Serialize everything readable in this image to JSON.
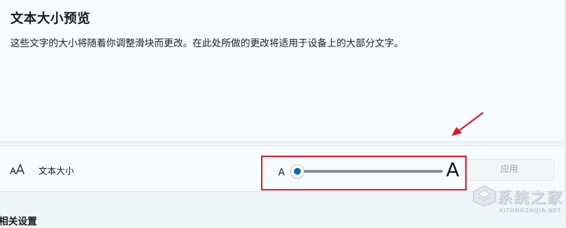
{
  "preview": {
    "title": "文本大小预览",
    "description": "这些文字的大小将随着你调整滑块而更改。在此处所做的更改将适用于设备上的大部分文字。"
  },
  "text_size_setting": {
    "icon": "text-size-icon",
    "label": "文本大小",
    "slider_min_label": "A",
    "slider_max_label": "A",
    "slider_value_fraction": 0.0,
    "apply_label": "应用",
    "apply_enabled": false
  },
  "related_settings": {
    "heading": "相关设置"
  },
  "annotation": {
    "color": "#e0141e"
  },
  "accent_color": "#0067c0",
  "watermark": {
    "brand": "系统之家",
    "url": "XITONGZHIJIA.NET"
  }
}
